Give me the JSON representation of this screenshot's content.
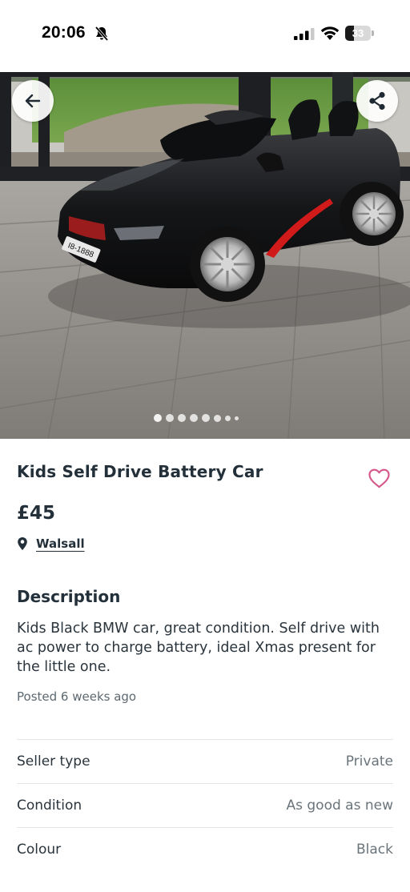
{
  "status_bar": {
    "time": "20:06",
    "battery_level": "33",
    "icons": [
      "bell-slash-icon",
      "cellular-signal-icon",
      "wifi-icon",
      "battery-icon"
    ]
  },
  "gallery": {
    "image_subject": "black kids ride-on car",
    "plate_text": "I8-1888",
    "slide_count": 8,
    "current_slide": 1,
    "icons": [
      "arrow-left-icon",
      "share-icon"
    ]
  },
  "listing": {
    "title": "Kids Self Drive Battery Car",
    "price": "£45",
    "location": "Walsall",
    "description_heading": "Description",
    "description": "Kids Black BMW car, great condition. Self drive with ac power to charge battery, ideal Xmas present for the little one.",
    "posted": "Posted 6 weeks ago",
    "favourite_icon": "heart-outline-icon",
    "location_icon": "map-pin-icon"
  },
  "attributes": [
    {
      "label": "Seller type",
      "value": "Private"
    },
    {
      "label": "Condition",
      "value": "As good as new"
    },
    {
      "label": "Colour",
      "value": "Black"
    }
  ],
  "colors": {
    "heading": "#23303a",
    "favourite": "#d6588a",
    "car_accent": "#d11a1a"
  }
}
